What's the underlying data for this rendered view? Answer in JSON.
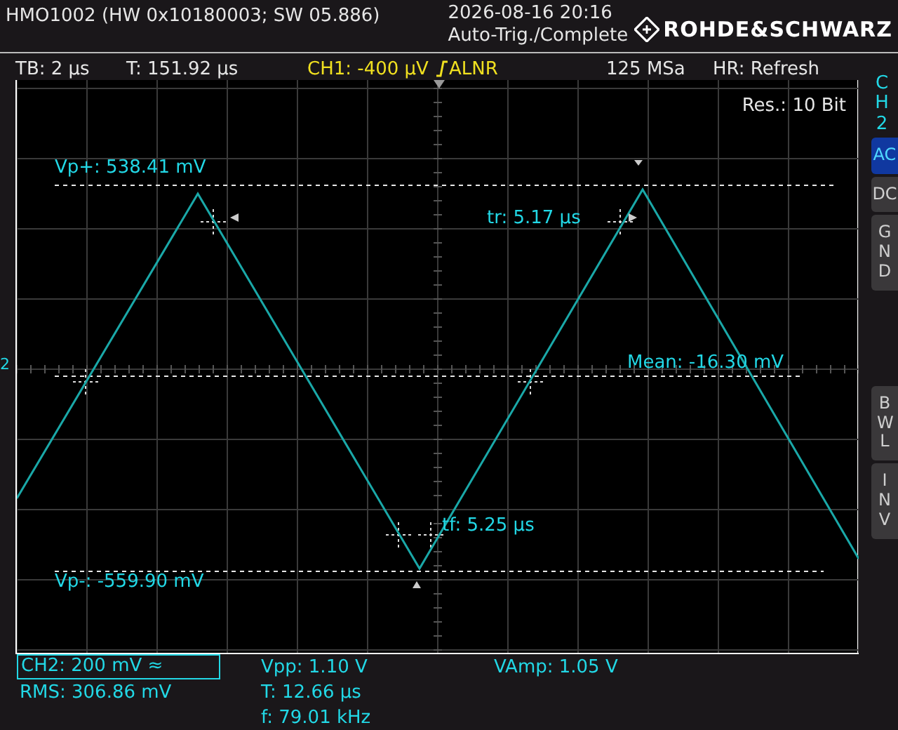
{
  "header": {
    "model": "HMO1002 (HW 0x10180003; SW 05.886)",
    "datetime": "2026-08-16 20:16",
    "trigger_status": "Auto-Trig./Complete",
    "brand": "ROHDE&SCHWARZ"
  },
  "status_bar": {
    "timebase": "TB: 2 µs",
    "trigger_time": "T: 151.92 µs",
    "trigger": "CH1: -400 µV",
    "trigger_mode": "ALNR",
    "sample_rate": "125 MSa",
    "acquisition": "HR: Refresh"
  },
  "plot": {
    "resolution": "Res.: 10 Bit",
    "channel_marker": "2",
    "annotations": [
      {
        "kind": "vp_plus",
        "text": "Vp+: 538.41 mV"
      },
      {
        "kind": "rise",
        "text": "tr: 5.17 µs"
      },
      {
        "kind": "mean",
        "text": "Mean: -16.30 mV"
      },
      {
        "kind": "fall",
        "text": "tf: 5.25 µs"
      },
      {
        "kind": "vp_minus",
        "text": "Vp-: -559.90 mV"
      }
    ]
  },
  "side_panel": {
    "channel": "CH2",
    "buttons": [
      {
        "label": "AC",
        "selected": true
      },
      {
        "label": "DC",
        "selected": false
      },
      {
        "label": "GND",
        "selected": false
      },
      {
        "label": "BWL",
        "selected": false
      },
      {
        "label": "INV",
        "selected": false
      }
    ]
  },
  "readout": {
    "channel_setting": "CH2: 200 mV ≈",
    "rms": "RMS: 306.86 mV",
    "vpp": "Vpp: 1.10 V",
    "period": "T: 12.66 µs",
    "frequency": "f: 79.01 kHz",
    "vamp": "VAmp: 1.05 V"
  }
}
